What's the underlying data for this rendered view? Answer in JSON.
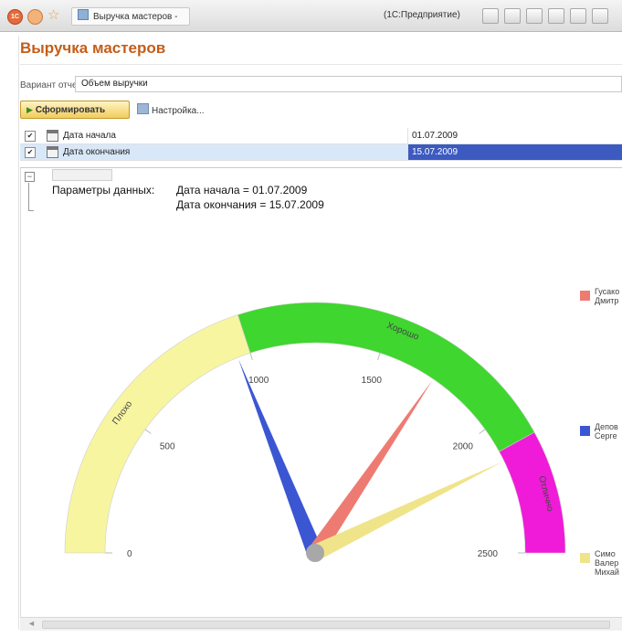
{
  "window": {
    "tab_title": "Выручка мастеров -",
    "app_name": "(1С:Предприятие)",
    "logo_text": "1С"
  },
  "report": {
    "title": "Выручка мастеров",
    "variant_label": "Вариант отчета:",
    "variant_value": "Объем выручки",
    "generate_label": "Сформировать",
    "settings_label": "Настройка..."
  },
  "params": [
    {
      "checked": true,
      "label": "Дата начала",
      "value": "01.07.2009",
      "selected": false
    },
    {
      "checked": true,
      "label": "Дата окончания",
      "value": "15.07.2009",
      "selected": true
    }
  ],
  "output": {
    "params_caption": "Параметры данных:",
    "params_line1": "Дата начала = 01.07.2009",
    "params_line2": "Дата окончания = 15.07.2009"
  },
  "chart_data": {
    "type": "gauge",
    "min": 0,
    "max": 2500,
    "ticks": [
      0,
      500,
      1000,
      1500,
      2000,
      2500
    ],
    "zones": [
      {
        "label": "Плохо",
        "from": 0,
        "to": 1000,
        "color": "#f7f5a0"
      },
      {
        "label": "Хорошо",
        "from": 1000,
        "to": 2100,
        "color": "#3fd62f"
      },
      {
        "label": "Отлично",
        "from": 2100,
        "to": 2500,
        "color": "#f01bd8"
      }
    ],
    "series": [
      {
        "name": "Гусако\nДмитр",
        "value": 950,
        "color": "#3b56d3"
      },
      {
        "name": "Депов\nСерге",
        "value": 1725,
        "color": "#ee7b72"
      },
      {
        "name": "Симо\nВалер\nМихай",
        "value": 2140,
        "color": "#f0e48a"
      }
    ]
  }
}
